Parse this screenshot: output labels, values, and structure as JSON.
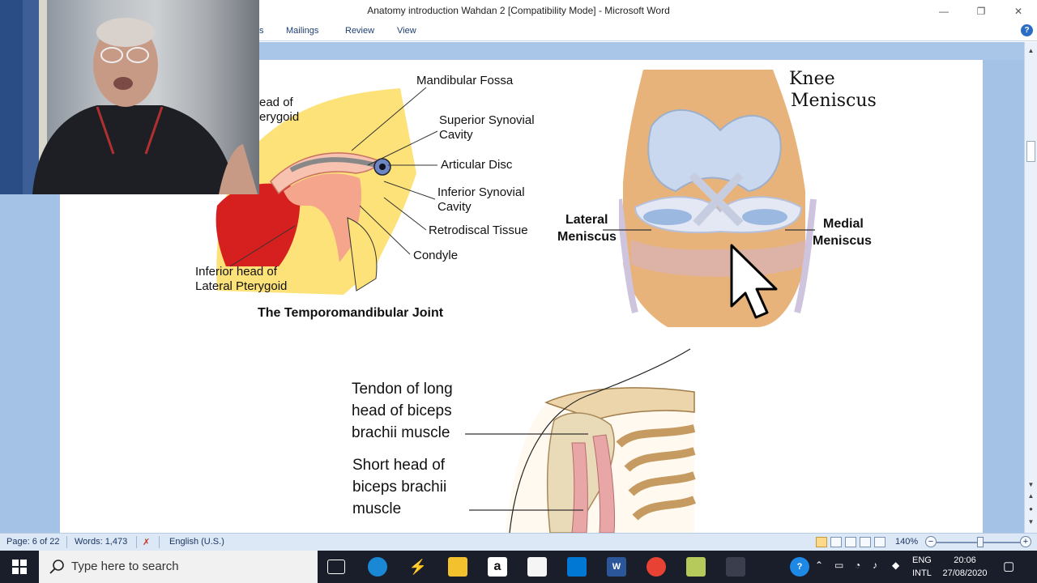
{
  "window": {
    "title": "Anatomy introduction Wahdan 2 [Compatibility Mode] - Microsoft Word",
    "minimize": "—",
    "restore": "❐",
    "close": "✕"
  },
  "ribbon": {
    "tabs": [
      "s",
      "Mailings",
      "Review",
      "View"
    ],
    "help": "?"
  },
  "tmj": {
    "labels": {
      "mandibular_fossa": "Mandibular Fossa",
      "superior_synovial": [
        "Superior Synovial",
        "Cavity"
      ],
      "articular_disc": "Articular Disc",
      "inferior_synovial": [
        "Inferior Synovial",
        "Cavity"
      ],
      "retrodiscal": "Retrodiscal Tissue",
      "condyle": "Condyle",
      "superior_head": [
        "ead of",
        "erygoid"
      ],
      "inferior_head": [
        "Inferior head of",
        "Lateral Pterygoid"
      ]
    },
    "caption": "The Temporomandibular Joint"
  },
  "knee": {
    "title": [
      "Knee",
      "Meniscus"
    ],
    "lateral": [
      "Lateral",
      "Meniscus"
    ],
    "medial": [
      "Medial",
      "Meniscus"
    ]
  },
  "shoulder": {
    "long_head": [
      "Tendon of long",
      "head of biceps",
      "brachii muscle"
    ],
    "short_head": [
      "Short head of",
      "biceps brachii",
      "muscle"
    ]
  },
  "statusbar": {
    "page": "Page: 6 of 22",
    "words": "Words: 1,473",
    "language": "English (U.S.)",
    "zoom": "140%"
  },
  "taskbar": {
    "search_placeholder": "Type here to search",
    "lang": [
      "ENG",
      "INTL"
    ],
    "time": "20:06",
    "date": "27/08/2020"
  },
  "colors": {
    "ribbon_text": "#1e3f73",
    "doc_background": "#a3c2e6",
    "statusbar": "#dce8f6",
    "taskbar": "#1a1d2a"
  }
}
